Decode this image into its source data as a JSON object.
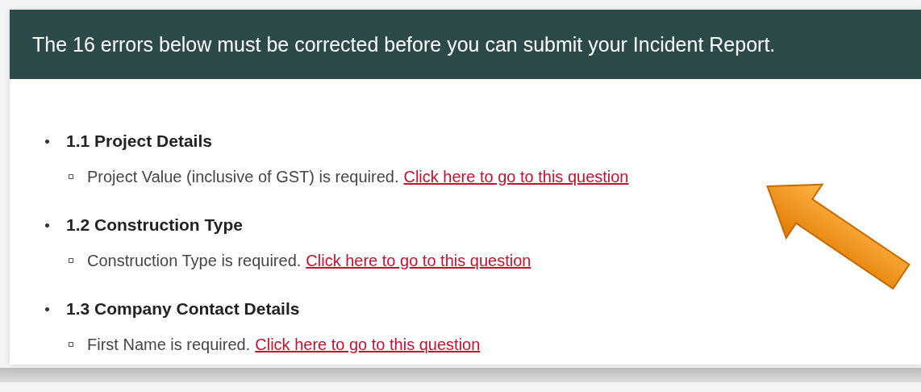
{
  "banner": {
    "message": "The 16 errors below must be corrected before you can submit your Incident Report."
  },
  "sections": [
    {
      "heading": "1.1 Project Details",
      "errors": [
        {
          "message": "Project Value (inclusive of GST) is required.",
          "link": "Click here to go to this question"
        }
      ]
    },
    {
      "heading": "1.2 Construction Type",
      "errors": [
        {
          "message": "Construction Type is required.",
          "link": "Click here to go to this question"
        }
      ]
    },
    {
      "heading": "1.3 Company Contact Details",
      "errors": [
        {
          "message": "First Name is required.",
          "link": "Click here to go to this question"
        }
      ]
    }
  ]
}
